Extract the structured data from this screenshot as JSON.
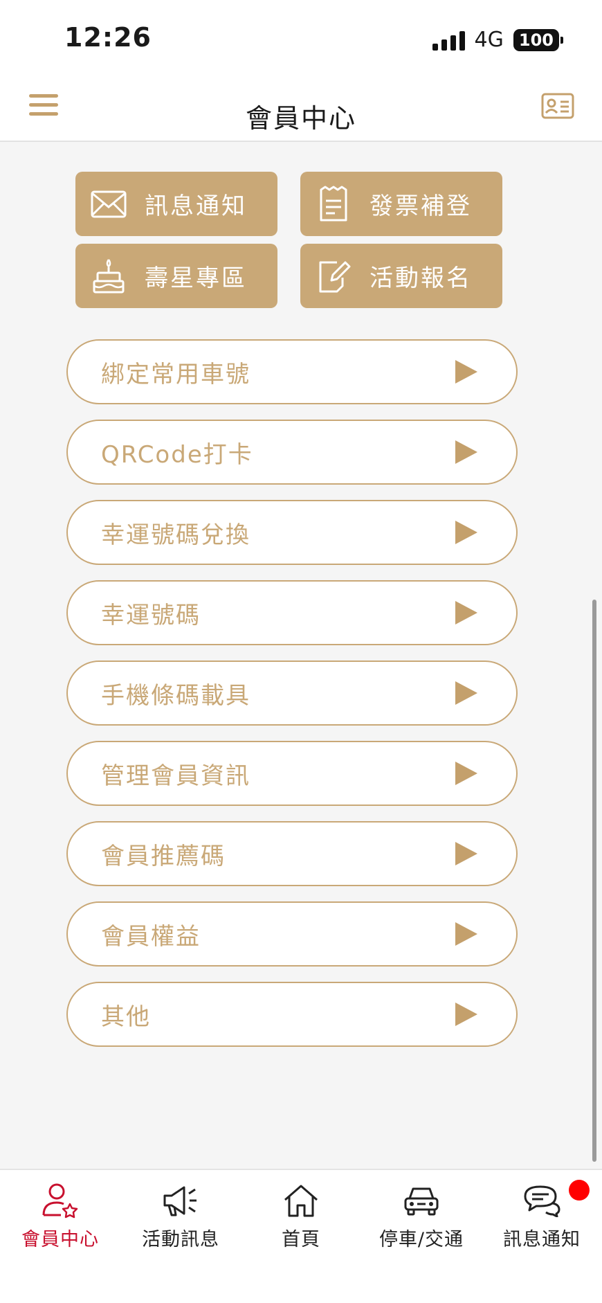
{
  "status": {
    "time": "12:26",
    "network": "4G",
    "battery": "100"
  },
  "header": {
    "title": "會員中心"
  },
  "quick_actions": [
    {
      "label": "訊息通知",
      "icon": "envelope-icon"
    },
    {
      "label": "發票補登",
      "icon": "receipt-icon"
    },
    {
      "label": "壽星專區",
      "icon": "birthday-cake-icon"
    },
    {
      "label": "活動報名",
      "icon": "edit-form-icon"
    }
  ],
  "menu_items": [
    {
      "label": "綁定常用車號"
    },
    {
      "label": "QRCode打卡"
    },
    {
      "label": "幸運號碼兌換"
    },
    {
      "label": "幸運號碼"
    },
    {
      "label": "手機條碼載具"
    },
    {
      "label": "管理會員資訊"
    },
    {
      "label": "會員推薦碼"
    },
    {
      "label": "會員權益"
    },
    {
      "label": "其他"
    }
  ],
  "tabs": [
    {
      "label": "會員中心",
      "icon": "member-star-icon",
      "active": true
    },
    {
      "label": "活動訊息",
      "icon": "megaphone-icon"
    },
    {
      "label": "首頁",
      "icon": "home-icon"
    },
    {
      "label": "停車/交通",
      "icon": "car-icon"
    },
    {
      "label": "訊息通知",
      "icon": "chat-bubbles-icon",
      "badge": true
    }
  ],
  "colors": {
    "accent": "#c9a877",
    "active_tab": "#c8102e",
    "badge": "#ff0000"
  }
}
